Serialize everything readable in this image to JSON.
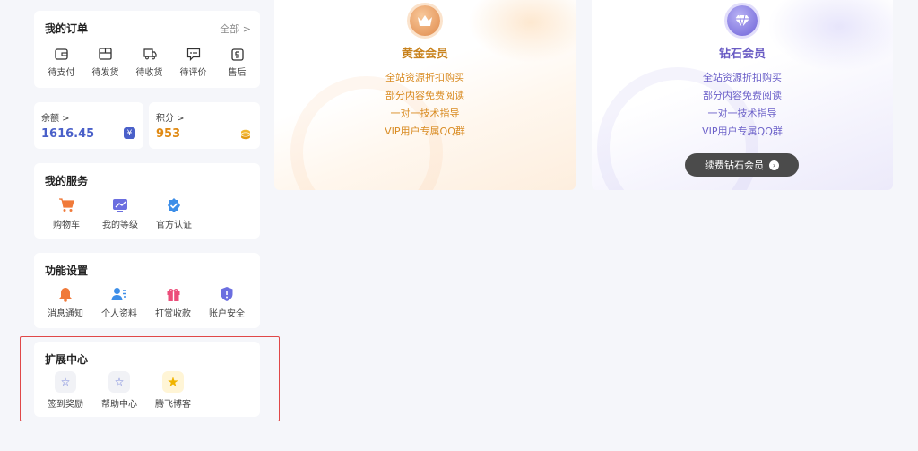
{
  "orders": {
    "title": "我的订单",
    "all_link": "全部 >",
    "items": [
      {
        "label": "待支付",
        "icon": "wallet-icon"
      },
      {
        "label": "待发货",
        "icon": "box-icon"
      },
      {
        "label": "待收货",
        "icon": "truck-icon"
      },
      {
        "label": "待评价",
        "icon": "comment-icon"
      },
      {
        "label": "售后",
        "icon": "after-sale-icon"
      }
    ]
  },
  "balance": {
    "label": "余额 >",
    "value": "1616.45",
    "icon": "yen-icon"
  },
  "points": {
    "label": "积分 >",
    "value": "953",
    "icon": "coins-icon"
  },
  "services": {
    "title": "我的服务",
    "items": [
      {
        "label": "购物车",
        "icon": "cart-icon"
      },
      {
        "label": "我的等级",
        "icon": "level-icon"
      },
      {
        "label": "官方认证",
        "icon": "verified-icon"
      }
    ]
  },
  "settings": {
    "title": "功能设置",
    "items": [
      {
        "label": "消息通知",
        "icon": "bell-icon"
      },
      {
        "label": "个人资料",
        "icon": "profile-icon"
      },
      {
        "label": "打赏收款",
        "icon": "gift-icon"
      },
      {
        "label": "账户安全",
        "icon": "shield-icon"
      }
    ]
  },
  "extensions": {
    "title": "扩展中心",
    "items": [
      {
        "label": "签到奖励",
        "icon": "star-icon"
      },
      {
        "label": "帮助中心",
        "icon": "star-icon"
      },
      {
        "label": "腾飞博客",
        "icon": "star-gold-icon"
      }
    ]
  },
  "vip_gold": {
    "name": "黄金会员",
    "features": [
      "全站资源折扣购买",
      "部分内容免费阅读",
      "一对一技术指导",
      "VIP用户专属QQ群"
    ]
  },
  "vip_diamond": {
    "name": "钻石会员",
    "features": [
      "全站资源折扣购买",
      "部分内容免费阅读",
      "一对一技术指导",
      "VIP用户专属QQ群"
    ],
    "button_label": "续费钻石会员"
  },
  "colors": {
    "accent_blue": "#4a60c9",
    "gold": "#c8821d",
    "diamond": "#6a5cc4",
    "highlight": "#e04848"
  }
}
